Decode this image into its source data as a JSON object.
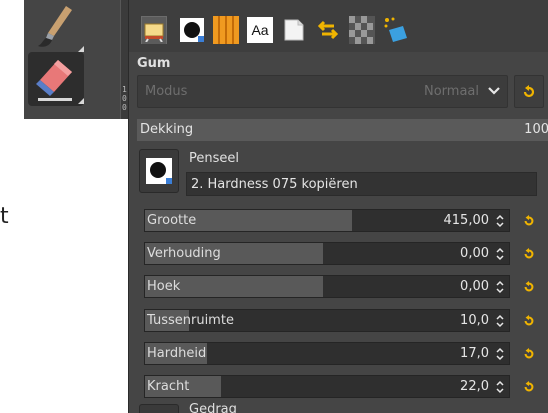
{
  "background_text": "t",
  "ruler_ticks": [
    "1",
    "0",
    "0"
  ],
  "tabs": [
    {
      "icon": "tool-options-icon",
      "active": true
    },
    {
      "icon": "brush-icon"
    },
    {
      "icon": "pattern-icon"
    },
    {
      "icon": "fonts-icon",
      "text": "Aa"
    },
    {
      "icon": "document-icon"
    },
    {
      "icon": "undo-history-icon"
    },
    {
      "icon": "gradient-icon"
    },
    {
      "icon": "device-status-icon"
    }
  ],
  "panel": {
    "title": "Gum",
    "mode": {
      "label": "Modus",
      "value": "Normaal"
    },
    "opacity": {
      "label": "Dekking",
      "value": "100"
    },
    "brush": {
      "label": "Penseel",
      "name": "2. Hardness 075 kopiëren"
    },
    "sliders": [
      {
        "label": "Grootte",
        "value": "415,00",
        "fraction": 0.57
      },
      {
        "label": "Verhouding",
        "value": "0,00",
        "fraction": 0.49
      },
      {
        "label": "Hoek",
        "value": "0,00",
        "fraction": 0.49
      },
      {
        "label": "Tussenruimte",
        "value": "10,0",
        "fraction": 0.12
      },
      {
        "label": "Hardheid",
        "value": "17,0",
        "fraction": 0.17
      },
      {
        "label": "Kracht",
        "value": "22,0",
        "fraction": 0.21
      }
    ],
    "next_label": "Gedrag"
  },
  "colors": {
    "accent_reset": "#f0b400",
    "panel_bg": "#454545"
  }
}
